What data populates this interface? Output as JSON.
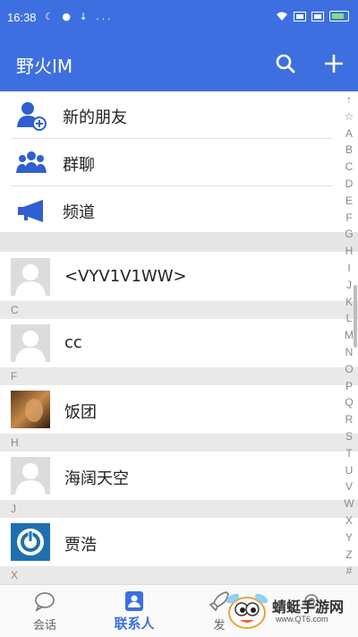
{
  "status_bar": {
    "time": "16:38",
    "notification_icons": "☾ ● ↓ ..."
  },
  "app_bar": {
    "title": "野火IM",
    "search_icon": "search-icon",
    "add_icon": "plus-icon"
  },
  "fixed_entries": [
    {
      "label": "新的朋友",
      "icon": "add-friend-icon"
    },
    {
      "label": "群聊",
      "icon": "group-chat-icon"
    },
    {
      "label": "频道",
      "icon": "channel-megaphone-icon"
    }
  ],
  "contacts": [
    {
      "name": "<VYV1V1WW>",
      "section": "",
      "avatar": "default-avatar"
    },
    {
      "name": "cc",
      "section": "C",
      "avatar": "default-avatar"
    },
    {
      "name": "饭团",
      "section": "F",
      "avatar": "photo-avatar"
    },
    {
      "name": "海阔天空",
      "section": "H",
      "avatar": "default-avatar"
    },
    {
      "name": "贾浩",
      "section": "J",
      "avatar": "power-button-avatar"
    }
  ],
  "trailing_section": "X",
  "index_letters": [
    "↑",
    "☆",
    "A",
    "B",
    "C",
    "D",
    "E",
    "F",
    "G",
    "H",
    "I",
    "J",
    "K",
    "L",
    "M",
    "N",
    "O",
    "P",
    "Q",
    "R",
    "S",
    "T",
    "U",
    "V",
    "W",
    "X",
    "Y",
    "Z",
    "#"
  ],
  "bottom_nav": [
    {
      "label": "会话",
      "icon": "chat-bubble-icon",
      "active": false
    },
    {
      "label": "联系人",
      "icon": "contact-card-icon",
      "active": true
    },
    {
      "label": "发",
      "icon": "rocket-icon",
      "active": false
    },
    {
      "label": "",
      "icon": "gear-icon",
      "active": false
    }
  ],
  "watermark": {
    "text": "蜻蜓手游网",
    "sub": "www.QT6.com"
  },
  "colors": {
    "primary": "#3d6fe0",
    "section_bg": "#e9e9e9",
    "icon_blue": "#2f5fd0"
  }
}
